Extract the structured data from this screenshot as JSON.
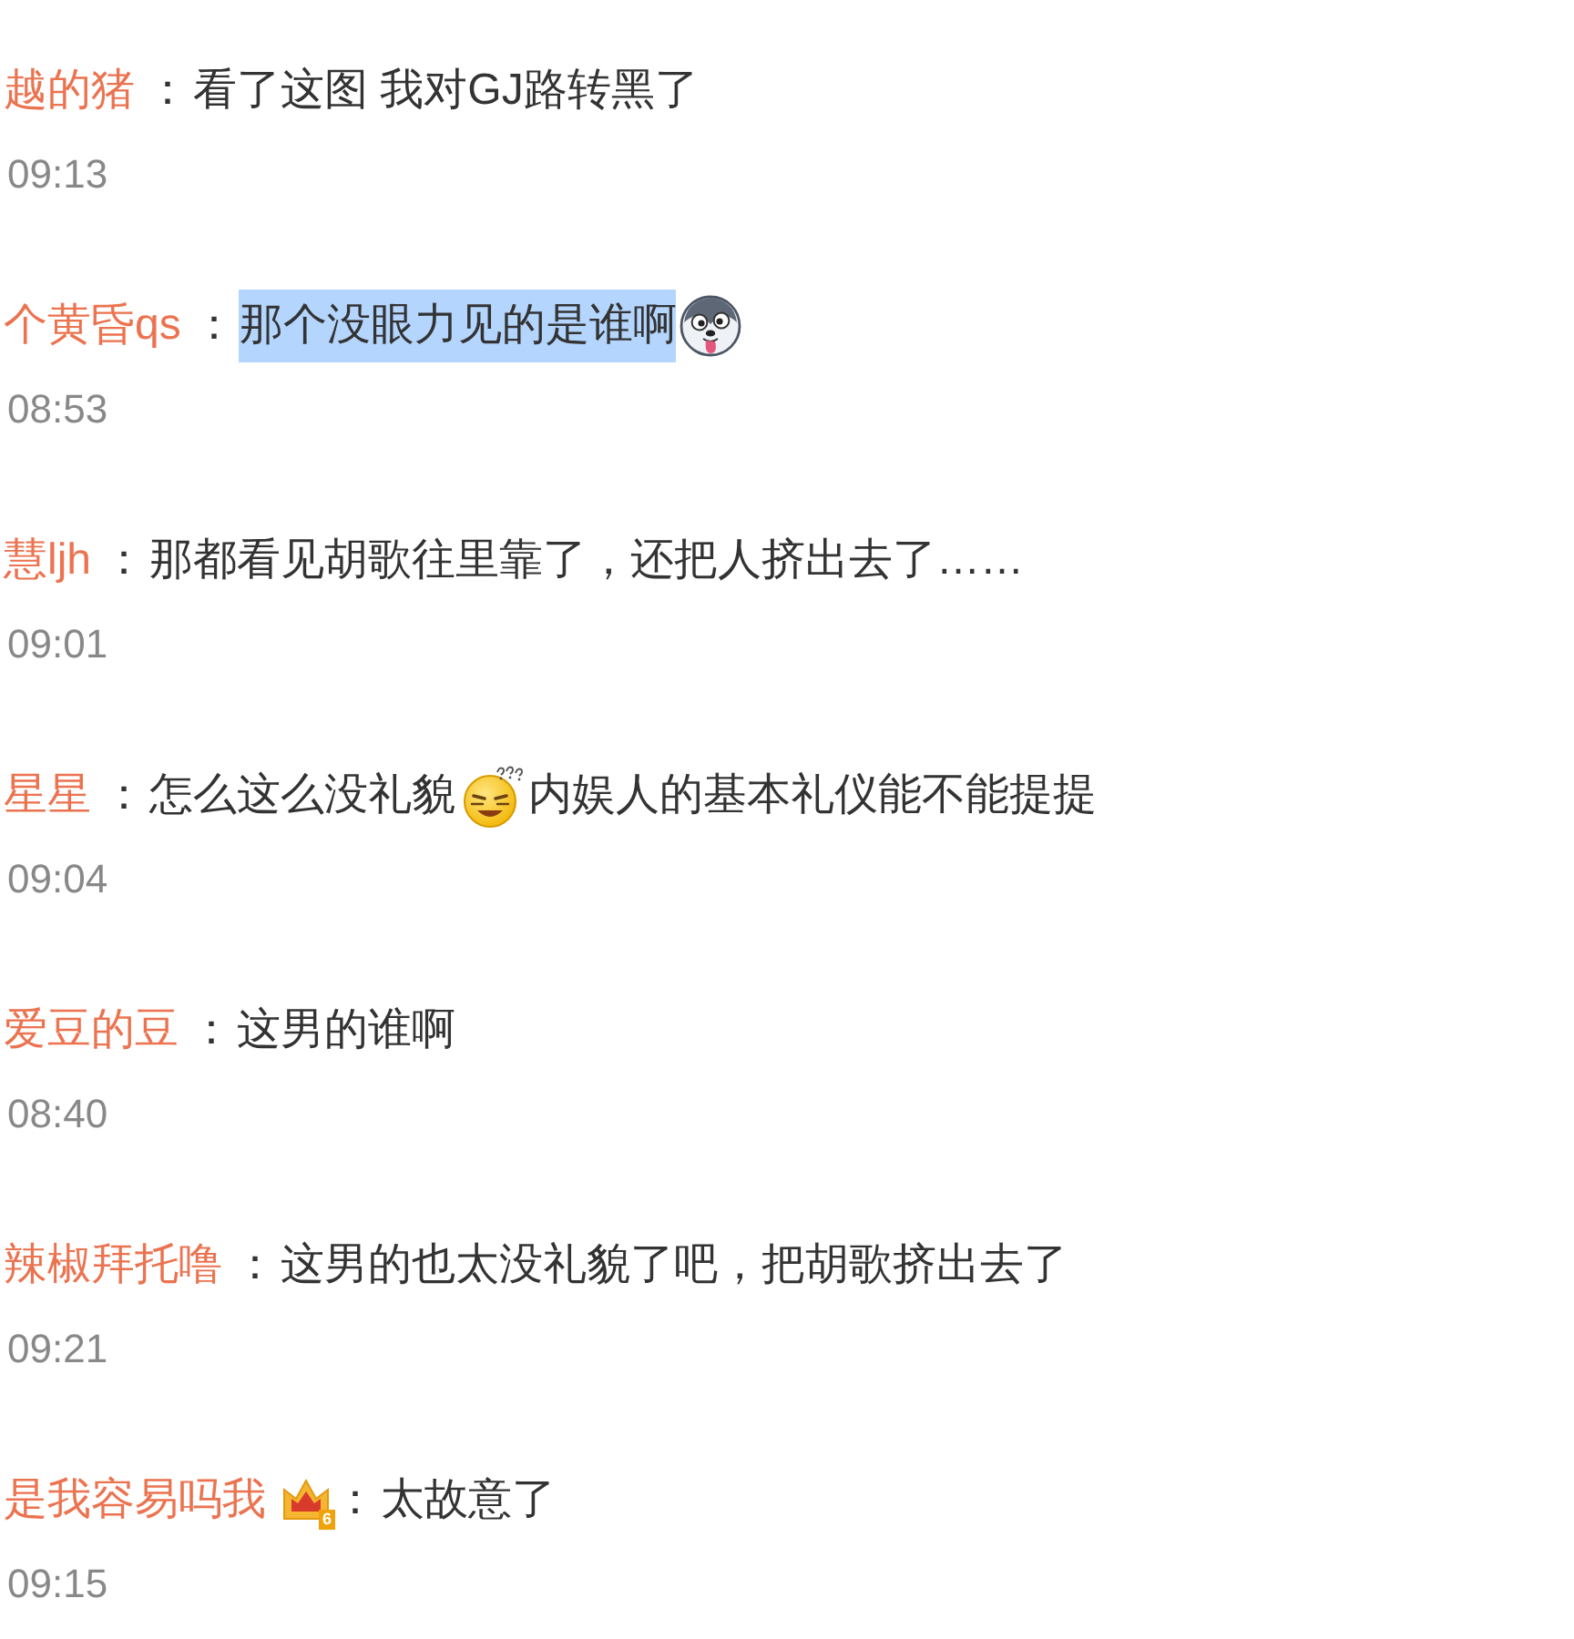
{
  "comments": [
    {
      "author": "越的猪",
      "colon": "：",
      "segments": [
        {
          "kind": "text",
          "text": "看了这图 我对GJ路转黑了"
        }
      ],
      "highlighted": false,
      "time": "09:13"
    },
    {
      "author": "个黄昏qs",
      "colon": "：",
      "segments": [
        {
          "kind": "text",
          "text": "那个没眼力见的是谁啊"
        },
        {
          "kind": "husky"
        }
      ],
      "highlighted": true,
      "time": "08:53"
    },
    {
      "author": "慧ljh",
      "colon": "：",
      "segments": [
        {
          "kind": "text",
          "text": "那都看见胡歌往里靠了，还把人挤出去了……"
        }
      ],
      "highlighted": false,
      "time": "09:01"
    },
    {
      "author": "星星",
      "colon": "：",
      "segments": [
        {
          "kind": "text",
          "text": "怎么这么没礼貌"
        },
        {
          "kind": "dizzy"
        },
        {
          "kind": "text",
          "text": "内娱人的基本礼仪能不能提提"
        }
      ],
      "highlighted": false,
      "time": "09:04"
    },
    {
      "author": "爱豆的豆",
      "colon": "：",
      "segments": [
        {
          "kind": "text",
          "text": "这男的谁啊"
        }
      ],
      "highlighted": false,
      "time": "08:40"
    },
    {
      "author": "辣椒拜托噜",
      "colon": "：",
      "segments": [
        {
          "kind": "text",
          "text": "这男的也太没礼貌了吧，把胡歌挤出去了"
        }
      ],
      "highlighted": false,
      "time": "09:21"
    },
    {
      "author": "是我容易吗我",
      "badge": {
        "kind": "crown",
        "text": "6"
      },
      "colon": "：",
      "segments": [
        {
          "kind": "text",
          "text": "太故意了"
        }
      ],
      "highlighted": false,
      "time": "09:15"
    }
  ]
}
